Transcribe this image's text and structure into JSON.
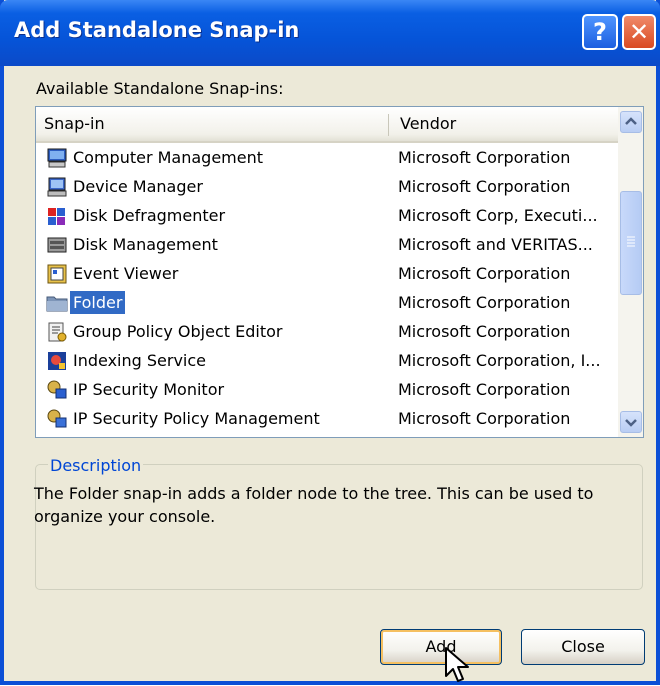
{
  "window": {
    "title": "Add Standalone Snap-in",
    "help_glyph": "?",
    "close_glyph": "✕"
  },
  "available_label": "Available Standalone Snap-ins:",
  "list": {
    "columns": [
      "Snap-in",
      "Vendor"
    ],
    "rows": [
      {
        "name": "Computer Management",
        "vendor": "Microsoft Corporation",
        "icon": "computer-management-icon",
        "selected": false
      },
      {
        "name": "Device Manager",
        "vendor": "Microsoft Corporation",
        "icon": "device-manager-icon",
        "selected": false
      },
      {
        "name": "Disk Defragmenter",
        "vendor": "Microsoft Corp, Executi...",
        "icon": "disk-defragmenter-icon",
        "selected": false
      },
      {
        "name": "Disk Management",
        "vendor": "Microsoft and VERITAS...",
        "icon": "disk-management-icon",
        "selected": false
      },
      {
        "name": "Event Viewer",
        "vendor": "Microsoft Corporation",
        "icon": "event-viewer-icon",
        "selected": false
      },
      {
        "name": "Folder",
        "vendor": "Microsoft Corporation",
        "icon": "folder-icon",
        "selected": true
      },
      {
        "name": "Group Policy Object Editor",
        "vendor": "Microsoft Corporation",
        "icon": "group-policy-icon",
        "selected": false
      },
      {
        "name": "Indexing Service",
        "vendor": "Microsoft Corporation, I...",
        "icon": "indexing-service-icon",
        "selected": false
      },
      {
        "name": "IP Security Monitor",
        "vendor": "Microsoft Corporation",
        "icon": "ip-security-monitor-icon",
        "selected": false
      },
      {
        "name": "IP Security Policy Management",
        "vendor": "Microsoft Corporation",
        "icon": "ip-security-policy-icon",
        "selected": false
      }
    ]
  },
  "description": {
    "legend": "Description",
    "text": "The Folder snap-in adds a folder node to the tree. This can be used to organize your console."
  },
  "buttons": {
    "add": "Add",
    "close": "Close"
  },
  "colors": {
    "titlebar": "#0654d8",
    "selection": "#316ac5",
    "dialog_bg": "#ece9d8",
    "legend_text": "#0046d5"
  }
}
